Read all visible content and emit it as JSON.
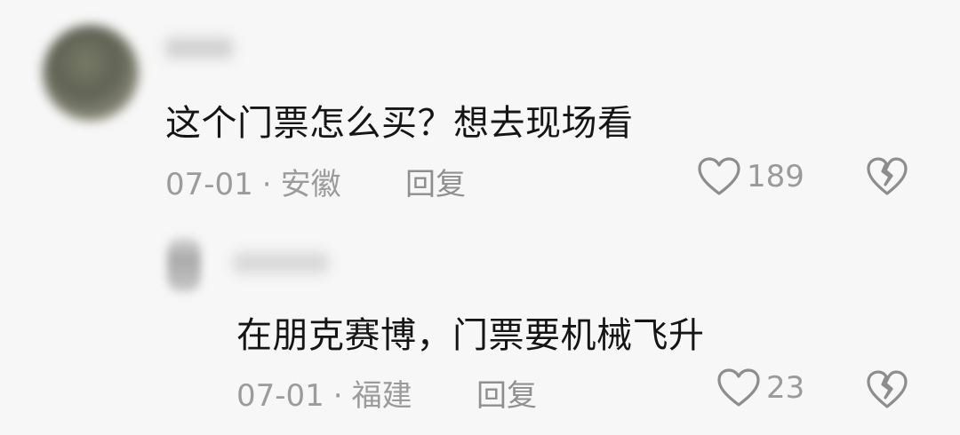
{
  "comments": [
    {
      "content": "这个门票怎么买？想去现场看",
      "date": "07-01",
      "separator": "·",
      "location": "安徽",
      "reply_label": "回复",
      "like_count": "189"
    },
    {
      "content": "在朋克赛博，门票要机械飞升",
      "date": "07-01",
      "separator": "·",
      "location": "福建",
      "reply_label": "回复",
      "like_count": "23"
    }
  ],
  "icons": {
    "like": "heart-outline-icon",
    "dislike": "broken-heart-icon"
  },
  "colors": {
    "background": "#f7f7f7",
    "text": "#151515",
    "meta": "#9b9b9b"
  }
}
